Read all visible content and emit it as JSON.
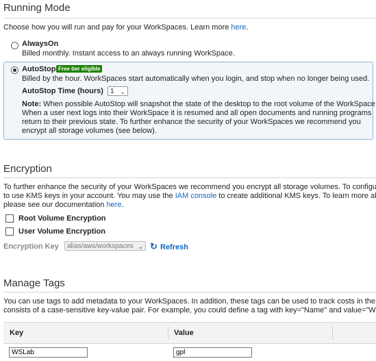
{
  "running_mode": {
    "title": "Running Mode",
    "intro_text": "Choose how you will run and pay for your WorkSpaces. Learn more ",
    "intro_link": "here",
    "intro_suffix": ".",
    "always_on": {
      "label": "AlwaysOn",
      "description": "Billed monthly. Instant access to an always running WorkSpace.",
      "selected": false
    },
    "auto_stop": {
      "label": "AutoStop",
      "badge": "Free tier eligible",
      "description": "Billed by the hour. WorkSpaces start automatically when you login, and stop when no longer being used.",
      "time_label": "AutoStop Time (hours)",
      "time_value": "1",
      "note_label": "Note:",
      "note_line1": " When possible AutoStop will snapshot the state of the desktop to the root volume of the WorkSpace.",
      "note_line2": "When a user next logs into their WorkSpace it is resumed and all open documents and running programs",
      "note_line3": "return to their previous state. To further enhance the security of your WorkSpaces we recommend you",
      "note_line4": "encrypt all storage volumes (see below).",
      "selected": true
    }
  },
  "encryption": {
    "title": "Encryption",
    "line1": "To further enhance the security of your WorkSpaces we recommend you encrypt all storage volumes. To configure vo",
    "line2_pre": "to use KMS keys in your account. You may use the ",
    "line2_link": "IAM console",
    "line2_post": " to create additional KMS keys. To learn more about",
    "line3_pre": "please see our documentation ",
    "line3_link": "here",
    "line3_post": ".",
    "root_volume_label": "Root Volume Encryption",
    "user_volume_label": "User Volume Encryption",
    "key_label": "Encryption Key",
    "key_value": "alias/aws/workspaces",
    "refresh_label": "Refresh"
  },
  "tags": {
    "title": "Manage Tags",
    "line1": "You can use tags to add metadata to your WorkSpaces. In addition, these tags can be used to track costs in the AWS",
    "line2": "consists of a case-sensitive key-value pair. For example, you could define a tag with key=\"Name\" and value=\"Webser",
    "col_key": "Key",
    "col_value": "Value",
    "row_key": "WSLab",
    "row_value": "gpl"
  },
  "colors": {
    "link": "#1166bb",
    "badge": "#1d8102",
    "selected_box": "#f2f6fb"
  }
}
